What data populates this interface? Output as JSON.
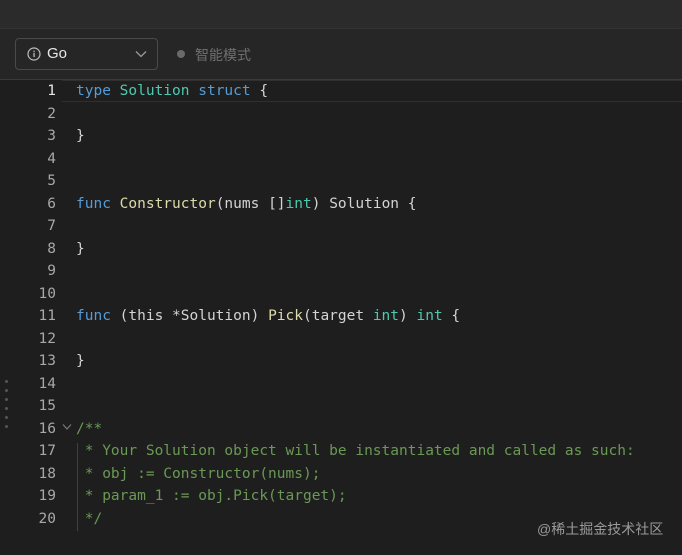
{
  "toolbar": {
    "language": "Go",
    "mode_label": "智能模式"
  },
  "editor": {
    "lines": [
      {
        "n": "1",
        "tokens": [
          {
            "t": "type",
            "c": "kw"
          },
          {
            "t": " "
          },
          {
            "t": "Solution",
            "c": "ty"
          },
          {
            "t": " "
          },
          {
            "t": "struct",
            "c": "kw"
          },
          {
            "t": " {"
          }
        ]
      },
      {
        "n": "2",
        "tokens": []
      },
      {
        "n": "3",
        "tokens": [
          {
            "t": "}"
          }
        ]
      },
      {
        "n": "4",
        "tokens": []
      },
      {
        "n": "5",
        "tokens": []
      },
      {
        "n": "6",
        "tokens": [
          {
            "t": "func",
            "c": "kw"
          },
          {
            "t": " "
          },
          {
            "t": "Constructor",
            "c": "fn"
          },
          {
            "t": "(nums []"
          },
          {
            "t": "int",
            "c": "ty"
          },
          {
            "t": ") Solution {"
          }
        ]
      },
      {
        "n": "7",
        "tokens": []
      },
      {
        "n": "8",
        "tokens": [
          {
            "t": "}"
          }
        ]
      },
      {
        "n": "9",
        "tokens": []
      },
      {
        "n": "10",
        "tokens": []
      },
      {
        "n": "11",
        "tokens": [
          {
            "t": "func",
            "c": "kw"
          },
          {
            "t": " (this *Solution) "
          },
          {
            "t": "Pick",
            "c": "fn"
          },
          {
            "t": "(target "
          },
          {
            "t": "int",
            "c": "ty"
          },
          {
            "t": ") "
          },
          {
            "t": "int",
            "c": "ty"
          },
          {
            "t": " {"
          }
        ]
      },
      {
        "n": "12",
        "tokens": []
      },
      {
        "n": "13",
        "tokens": [
          {
            "t": "}"
          }
        ]
      },
      {
        "n": "14",
        "tokens": []
      },
      {
        "n": "15",
        "tokens": []
      },
      {
        "n": "16",
        "tokens": [
          {
            "t": "/**",
            "c": "cm"
          }
        ]
      },
      {
        "n": "17",
        "tokens": [
          {
            "t": " * Your Solution object will be instantiated and called as such:",
            "c": "cm"
          }
        ]
      },
      {
        "n": "18",
        "tokens": [
          {
            "t": " * obj := Constructor(nums);",
            "c": "cm"
          }
        ]
      },
      {
        "n": "19",
        "tokens": [
          {
            "t": " * param_1 := obj.Pick(target);",
            "c": "cm"
          }
        ]
      },
      {
        "n": "20",
        "tokens": [
          {
            "t": " */",
            "c": "cm"
          }
        ]
      }
    ]
  },
  "watermark": "@稀土掘金技术社区"
}
